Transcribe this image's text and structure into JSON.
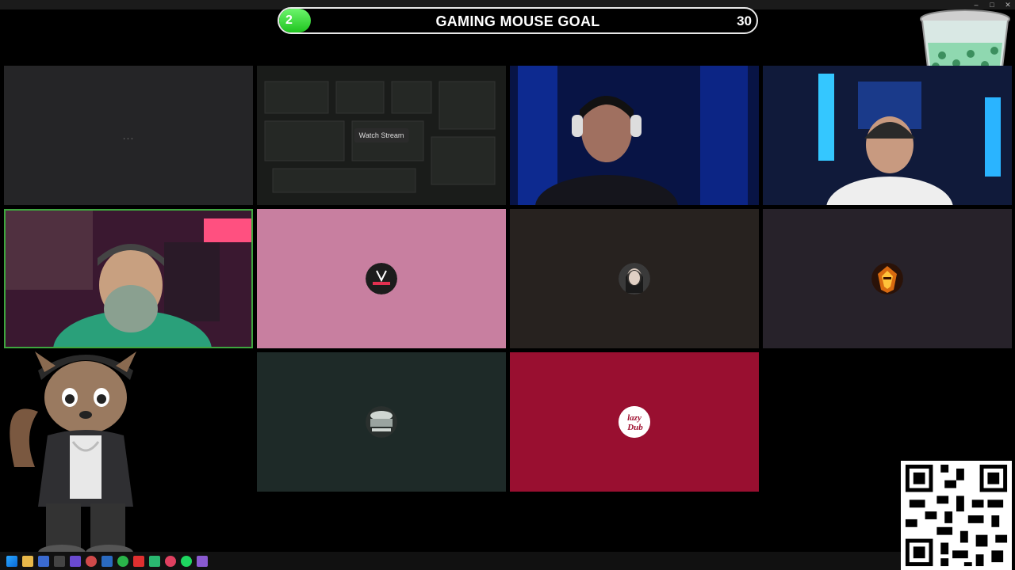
{
  "goal": {
    "current": "2",
    "title": "GAMING MOUSE GOAL",
    "target": "30",
    "progress_fraction": 0.0667
  },
  "tiles": [
    {
      "name": "tile-empty",
      "bg": "#252527",
      "kind": "loading",
      "text": "..."
    },
    {
      "name": "tile-screen-share",
      "bg": "#1c1e1c",
      "kind": "stream",
      "text": "Watch Stream"
    },
    {
      "name": "tile-webcam-headphones",
      "bg": "#0a1a55",
      "kind": "video"
    },
    {
      "name": "tile-webcam-tropical-shirt",
      "bg": "#1a2a5a",
      "kind": "video"
    },
    {
      "name": "tile-webcam-bearded-streamer",
      "bg": "#3a1830",
      "kind": "video",
      "active": true
    },
    {
      "name": "tile-bossraiser",
      "bg": "#c87fa0",
      "kind": "avatar",
      "avatar_bg": "#202020"
    },
    {
      "name": "tile-dark-avatar",
      "bg": "#27221f",
      "kind": "avatar",
      "avatar_bg": "#555"
    },
    {
      "name": "tile-flame-avatar",
      "bg": "#27222a",
      "kind": "avatar",
      "avatar_bg": "#6a2a08"
    },
    {
      "name": "tile-jawnsauce",
      "bg": "#1e2a28",
      "kind": "avatar",
      "avatar_bg": "#3a403e"
    },
    {
      "name": "tile-lazy-dub",
      "bg": "#990f30",
      "kind": "avatar",
      "avatar_bg": "#ffffff",
      "avatar_text": "lazy Dub"
    }
  ],
  "colors": {
    "active_border": "#3ea63e",
    "goal_fill": "#2ed12e"
  },
  "taskbar_icons": [
    "windows-start-icon",
    "folder-icon",
    "app-icon",
    "app-icon",
    "app-icon",
    "app-icon",
    "app-icon",
    "app-icon",
    "app-icon",
    "app-icon",
    "spotify-icon",
    "app-icon"
  ]
}
